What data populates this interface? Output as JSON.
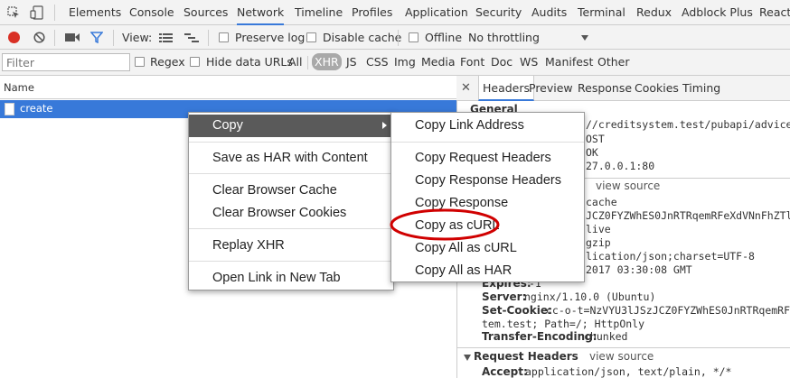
{
  "tabs": [
    "Elements",
    "Console",
    "Sources",
    "Network",
    "Timeline",
    "Profiles",
    "Application",
    "Security",
    "Audits",
    "Terminal",
    "Redux",
    "Adblock Plus",
    "React"
  ],
  "toolbar": {
    "view_label": "View:",
    "preserve_log": "Preserve log",
    "disable_cache": "Disable cache",
    "offline": "Offline",
    "throttling": "No throttling"
  },
  "filter": {
    "placeholder": "Filter",
    "regex": "Regex",
    "hide_data_urls": "Hide data URLs",
    "types": [
      "All",
      "XHR",
      "JS",
      "CSS",
      "Img",
      "Media",
      "Font",
      "Doc",
      "WS",
      "Manifest",
      "Other"
    ],
    "selected": "XHR"
  },
  "requests": {
    "name_header": "Name",
    "rows": [
      "create"
    ]
  },
  "details": {
    "tabs": [
      "Headers",
      "Preview",
      "Response",
      "Cookies",
      "Timing"
    ],
    "active_tab": "Headers",
    "general_label": "General",
    "general_lines": [
      "//creditsystem.test/pubapi/advice/",
      "OST",
      "OK",
      "27.0.0.1:80"
    ],
    "view_source_1": "view source",
    "response_lines": [
      "cache",
      "JCZ0FYZWhES0JnRTRqemRFeXdVNnFhZTlGVz",
      "live",
      "gzip",
      "lication/json;charset=UTF-8",
      "2017 03:30:08 GMT"
    ],
    "headers": [
      {
        "name": "Expires:",
        "value": "-1"
      },
      {
        "name": "Server:",
        "value": "nginx/1.10.0 (Ubuntu)"
      },
      {
        "name": "Set-Cookie:",
        "value": "cc-o-t=NzVYU3lJSzJCZ0FYZWhES0JnRTRqemRFeX"
      },
      {
        "name": "",
        "value": "tem.test; Path=/; HttpOnly"
      },
      {
        "name": "Transfer-Encoding:",
        "value": "chunked"
      }
    ],
    "request_headers_label": "Request Headers",
    "view_source_2": "view source",
    "accept_name": "Accept:",
    "accept_value": "application/json, text/plain, */*"
  },
  "context_menu": {
    "items": [
      "Copy",
      "Save as HAR with Content",
      "Clear Browser Cache",
      "Clear Browser Cookies",
      "Replay XHR",
      "Open Link in New Tab"
    ],
    "highlighted": "Copy"
  },
  "copy_submenu": {
    "items": [
      "Copy Link Address",
      "Copy Request Headers",
      "Copy Response Headers",
      "Copy Response",
      "Copy as cURL",
      "Copy All as cURL",
      "Copy All as HAR"
    ],
    "circled": "Copy as cURL"
  },
  "colors": {
    "accent": "#3879d9",
    "record": "#d93025",
    "circle": "#d00000"
  }
}
